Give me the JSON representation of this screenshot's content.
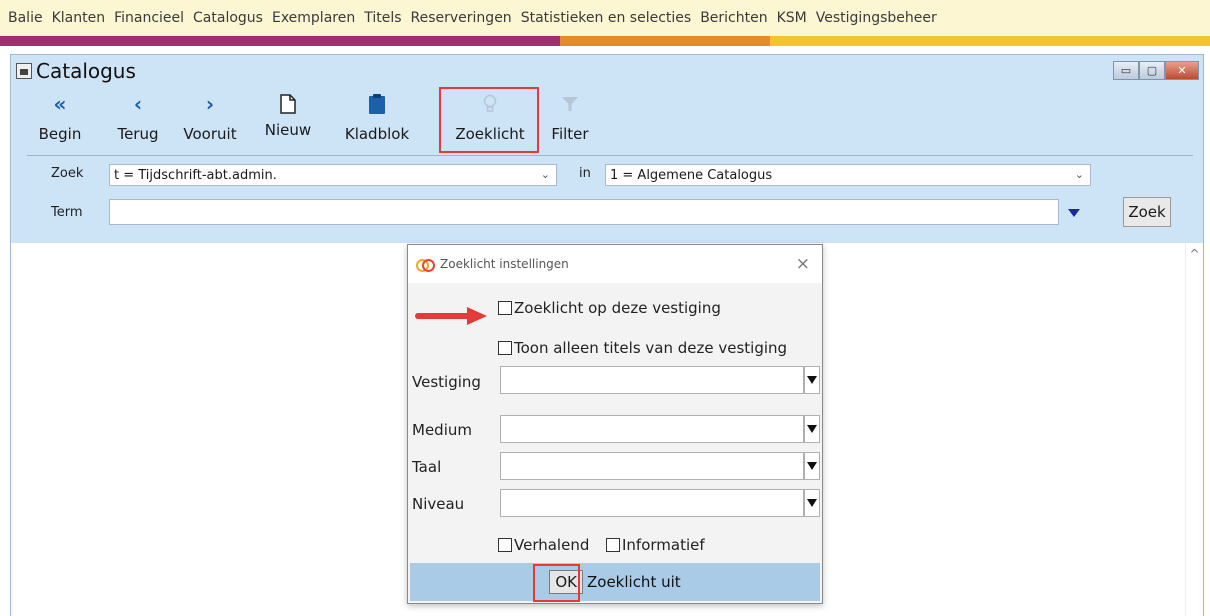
{
  "menubar": {
    "items": [
      "Balie",
      "Klanten",
      "Financieel",
      "Catalogus",
      "Exemplaren",
      "Titels",
      "Reserveringen",
      "Statistieken en selecties",
      "Berichten",
      "KSM",
      "Vestigingsbeheer"
    ]
  },
  "colors": {
    "stripe_purple": "#a0306d",
    "stripe_orange": "#e48b2a",
    "stripe_yellow": "#f2c52f",
    "window_bg": "#cde3f6",
    "accent_red": "#e33a3a"
  },
  "window": {
    "title": "Catalogus",
    "controls": {
      "minimize": "▭",
      "maximize": "▢",
      "close": "✕"
    }
  },
  "toolbar": {
    "begin": {
      "label": "Begin",
      "icon": "«"
    },
    "terug": {
      "label": "Terug",
      "icon": "‹"
    },
    "vooruit": {
      "label": "Vooruit",
      "icon": "›"
    },
    "nieuw": {
      "label": "Nieuw",
      "icon": "new-document-icon"
    },
    "kladblok": {
      "label": "Kladblok",
      "icon": "clipboard-icon"
    },
    "zoeklicht": {
      "label": "Zoeklicht",
      "icon": "lightbulb-icon"
    },
    "filter": {
      "label": "Filter",
      "icon": "filter-icon"
    }
  },
  "search": {
    "zoek_label": "Zoek",
    "zoek_value": "t = Tijdschrift-abt.admin.",
    "in_label": "in",
    "catalog_value": "1 = Algemene Catalogus",
    "term_label": "Term",
    "term_value": "",
    "zoek_button": "Zoek"
  },
  "dialog": {
    "title": "Zoeklicht instellingen",
    "close": "×",
    "checkbox_vestiging": "Zoeklicht op deze vestiging",
    "checkbox_toon": "Toon alleen titels van deze vestiging",
    "vestiging_label": "Vestiging",
    "medium_label": "Medium",
    "taal_label": "Taal",
    "niveau_label": "Niveau",
    "vestiging_value": "",
    "medium_value": "",
    "taal_value": "",
    "niveau_value": "",
    "checkbox_verhalend": "Verhalend",
    "checkbox_informatief": "Informatief",
    "ok_button": "OK",
    "off_button": "Zoeklicht uit"
  }
}
